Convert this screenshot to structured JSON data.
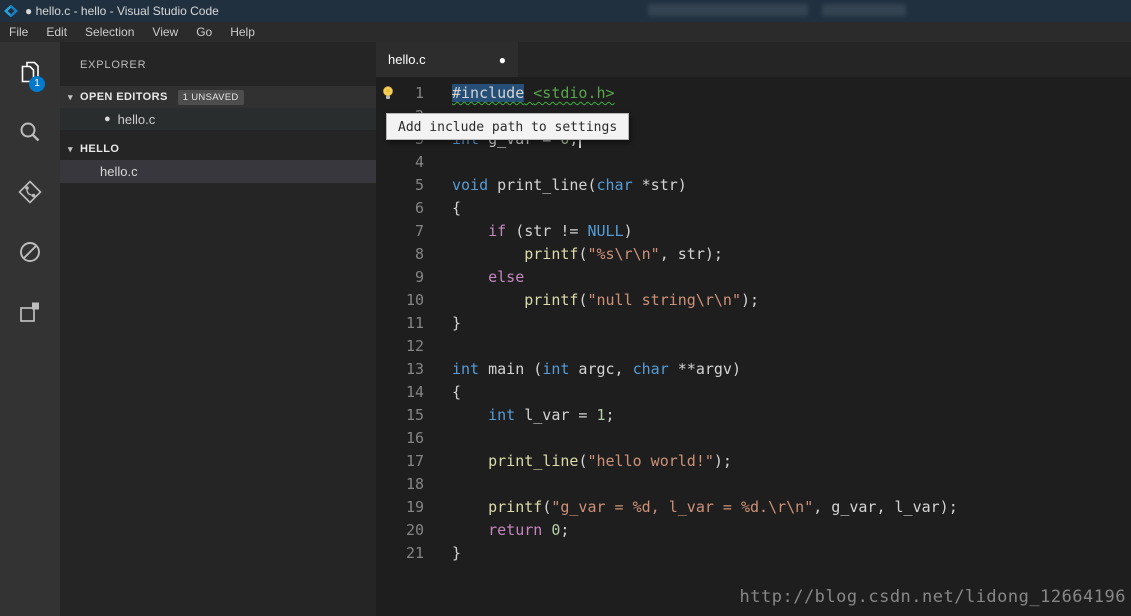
{
  "window": {
    "title": "● hello.c - hello - Visual Studio Code",
    "menus": [
      "File",
      "Edit",
      "Selection",
      "View",
      "Go",
      "Help"
    ]
  },
  "activity_bar": {
    "badge": "1",
    "items": [
      {
        "name": "explorer-icon"
      },
      {
        "name": "search-icon"
      },
      {
        "name": "source-control-icon"
      },
      {
        "name": "debug-icon"
      },
      {
        "name": "extensions-icon"
      }
    ]
  },
  "sidebar": {
    "title": "EXPLORER",
    "open_editors": {
      "label": "OPEN EDITORS",
      "badge": "1 UNSAVED",
      "items": [
        {
          "dirty": "●",
          "label": "hello.c"
        }
      ]
    },
    "folder": {
      "label": "HELLO",
      "items": [
        {
          "label": "hello.c"
        }
      ]
    }
  },
  "editor": {
    "tab": {
      "label": "hello.c",
      "dirty": "●"
    },
    "tooltip": "Add include path to settings",
    "code": {
      "lines": [
        {
          "n": "1",
          "segs": [
            {
              "t": "#include",
              "c": "pp sel sq"
            },
            {
              "t": " ",
              "c": "pl sq"
            },
            {
              "t": "<stdio.h>",
              "c": "inc sq"
            }
          ]
        },
        {
          "n": "2",
          "segs": []
        },
        {
          "n": "3",
          "cursor": true,
          "segs": [
            {
              "t": "int",
              "c": "kw"
            },
            {
              "t": " g_var = ",
              "c": "pl"
            },
            {
              "t": "0",
              "c": "num"
            },
            {
              "t": ";",
              "c": "pl"
            }
          ]
        },
        {
          "n": "4",
          "segs": []
        },
        {
          "n": "5",
          "segs": [
            {
              "t": "void",
              "c": "kw"
            },
            {
              "t": " print_line(",
              "c": "pl"
            },
            {
              "t": "char",
              "c": "kw"
            },
            {
              "t": " *str)",
              "c": "pl"
            }
          ]
        },
        {
          "n": "6",
          "segs": [
            {
              "t": "{",
              "c": "pl"
            }
          ]
        },
        {
          "n": "7",
          "segs": [
            {
              "t": "    ",
              "c": "pl"
            },
            {
              "t": "if",
              "c": "ctl"
            },
            {
              "t": " (str != ",
              "c": "pl"
            },
            {
              "t": "NULL",
              "c": "kw"
            },
            {
              "t": ")",
              "c": "pl"
            }
          ]
        },
        {
          "n": "8",
          "segs": [
            {
              "t": "        ",
              "c": "pl"
            },
            {
              "t": "printf",
              "c": "fn"
            },
            {
              "t": "(",
              "c": "pl"
            },
            {
              "t": "\"%s\\r\\n\"",
              "c": "str"
            },
            {
              "t": ", str);",
              "c": "pl"
            }
          ]
        },
        {
          "n": "9",
          "segs": [
            {
              "t": "    ",
              "c": "pl"
            },
            {
              "t": "else",
              "c": "ctl"
            }
          ]
        },
        {
          "n": "10",
          "segs": [
            {
              "t": "        ",
              "c": "pl"
            },
            {
              "t": "printf",
              "c": "fn"
            },
            {
              "t": "(",
              "c": "pl"
            },
            {
              "t": "\"null string\\r\\n\"",
              "c": "str"
            },
            {
              "t": ");",
              "c": "pl"
            }
          ]
        },
        {
          "n": "11",
          "segs": [
            {
              "t": "}",
              "c": "pl"
            }
          ]
        },
        {
          "n": "12",
          "segs": []
        },
        {
          "n": "13",
          "segs": [
            {
              "t": "int",
              "c": "kw"
            },
            {
              "t": " main (",
              "c": "pl"
            },
            {
              "t": "int",
              "c": "kw"
            },
            {
              "t": " argc, ",
              "c": "pl"
            },
            {
              "t": "char",
              "c": "kw"
            },
            {
              "t": " **argv)",
              "c": "pl"
            }
          ]
        },
        {
          "n": "14",
          "segs": [
            {
              "t": "{",
              "c": "pl"
            }
          ]
        },
        {
          "n": "15",
          "segs": [
            {
              "t": "    ",
              "c": "pl"
            },
            {
              "t": "int",
              "c": "kw"
            },
            {
              "t": " l_var = ",
              "c": "pl"
            },
            {
              "t": "1",
              "c": "num"
            },
            {
              "t": ";",
              "c": "pl"
            }
          ]
        },
        {
          "n": "16",
          "segs": []
        },
        {
          "n": "17",
          "segs": [
            {
              "t": "    ",
              "c": "pl"
            },
            {
              "t": "print_line",
              "c": "fn"
            },
            {
              "t": "(",
              "c": "pl"
            },
            {
              "t": "\"hello world!\"",
              "c": "str"
            },
            {
              "t": ");",
              "c": "pl"
            }
          ]
        },
        {
          "n": "18",
          "segs": []
        },
        {
          "n": "19",
          "segs": [
            {
              "t": "    ",
              "c": "pl"
            },
            {
              "t": "printf",
              "c": "fn"
            },
            {
              "t": "(",
              "c": "pl"
            },
            {
              "t": "\"g_var = %d, l_var = %d.\\r\\n\"",
              "c": "str"
            },
            {
              "t": ", g_var, l_var);",
              "c": "pl"
            }
          ]
        },
        {
          "n": "20",
          "segs": [
            {
              "t": "    ",
              "c": "pl"
            },
            {
              "t": "return",
              "c": "ctl"
            },
            {
              "t": " ",
              "c": "pl"
            },
            {
              "t": "0",
              "c": "num"
            },
            {
              "t": ";",
              "c": "pl"
            }
          ]
        },
        {
          "n": "21",
          "segs": [
            {
              "t": "}",
              "c": "pl"
            }
          ]
        }
      ]
    }
  },
  "watermark": "http://blog.csdn.net/lidong_12664196",
  "colors": {
    "accent": "#007acc",
    "selection": "#264f78",
    "squiggle": "#3fae3f",
    "badge_bg": "#4d4d4d",
    "keyword": "#569cd6",
    "control": "#c586c0",
    "string": "#ce9178",
    "number": "#b5cea8",
    "function": "#dcdcaa",
    "include_path": "#57a64a"
  }
}
